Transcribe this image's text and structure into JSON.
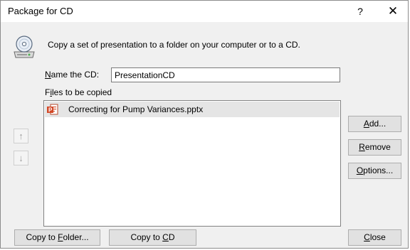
{
  "window": {
    "title": "Package for CD",
    "help_glyph": "?",
    "close_glyph": "✕"
  },
  "description": "Copy a set of presentation to a folder on your computer or to a CD.",
  "name_field": {
    "label_prefix": "",
    "label_accel": "N",
    "label_rest": "ame the CD:",
    "value": "PresentationCD"
  },
  "files": {
    "label_prefix": "F",
    "label_accel": "i",
    "label_rest": "les to be copied",
    "items": [
      {
        "name": "Correcting for Pump Variances.pptx"
      }
    ]
  },
  "move_up_glyph": "↑",
  "move_down_glyph": "↓",
  "buttons": {
    "add": {
      "pre": "",
      "accel": "A",
      "post": "dd..."
    },
    "remove": {
      "pre": "",
      "accel": "R",
      "post": "emove"
    },
    "options": {
      "pre": "",
      "accel": "O",
      "post": "ptions..."
    },
    "copy_folder": {
      "pre": "Copy to ",
      "accel": "F",
      "post": "older..."
    },
    "copy_cd": {
      "pre": "Copy to ",
      "accel": "C",
      "post": "D"
    },
    "close": {
      "pre": "",
      "accel": "C",
      "post": "lose"
    }
  },
  "icons": {
    "cd": "cd-drive-icon",
    "file": "powerpoint-file-icon"
  }
}
